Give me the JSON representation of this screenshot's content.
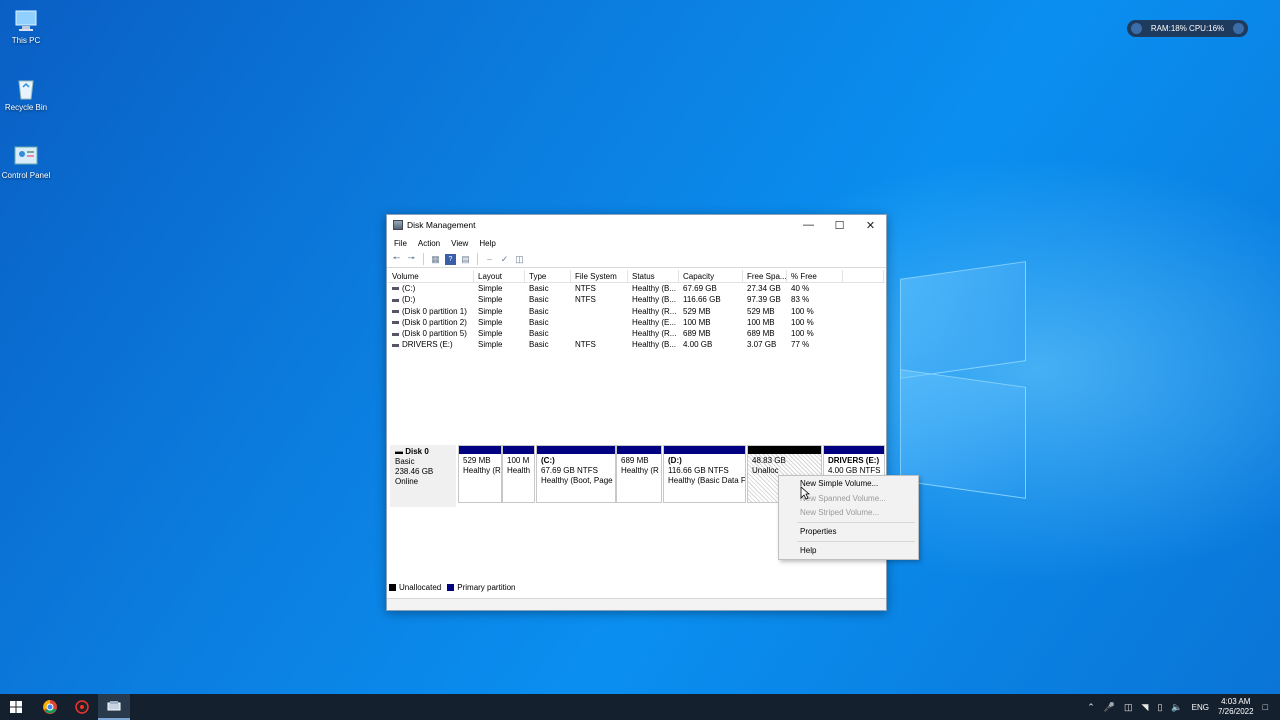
{
  "desktop": {
    "icons": [
      {
        "label": "This PC"
      },
      {
        "label": "Recycle Bin"
      },
      {
        "label": "Control Panel"
      }
    ],
    "sysmon": {
      "text": "RAM:18%  CPU:16%"
    }
  },
  "window": {
    "title": "Disk Management",
    "menu": [
      "File",
      "Action",
      "View",
      "Help"
    ],
    "columns": [
      "Volume",
      "Layout",
      "Type",
      "File System",
      "Status",
      "Capacity",
      "Free Spa...",
      "% Free",
      ""
    ],
    "rows": [
      [
        "(C:)",
        "Simple",
        "Basic",
        "NTFS",
        "Healthy (B...",
        "67.69 GB",
        "27.34 GB",
        "40 %"
      ],
      [
        "(D:)",
        "Simple",
        "Basic",
        "NTFS",
        "Healthy (B...",
        "116.66 GB",
        "97.39 GB",
        "83 %"
      ],
      [
        "(Disk 0 partition 1)",
        "Simple",
        "Basic",
        "",
        "Healthy (R...",
        "529 MB",
        "529 MB",
        "100 %"
      ],
      [
        "(Disk 0 partition 2)",
        "Simple",
        "Basic",
        "",
        "Healthy (E...",
        "100 MB",
        "100 MB",
        "100 %"
      ],
      [
        "(Disk 0 partition 5)",
        "Simple",
        "Basic",
        "",
        "Healthy (R...",
        "689 MB",
        "689 MB",
        "100 %"
      ],
      [
        "DRIVERS (E:)",
        "Simple",
        "Basic",
        "NTFS",
        "Healthy (B...",
        "4.00 GB",
        "3.07 GB",
        "77 %"
      ]
    ],
    "disk": {
      "name": "Disk 0",
      "type": "Basic",
      "size": "238.46 GB",
      "state": "Online",
      "partitions": [
        {
          "title": "",
          "line1": "529 MB",
          "line2": "Healthy (R"
        },
        {
          "title": "",
          "line1": "100 M",
          "line2": "Health"
        },
        {
          "title": "(C:)",
          "line1": "67.69 GB NTFS",
          "line2": "Healthy (Boot, Page"
        },
        {
          "title": "",
          "line1": "689 MB",
          "line2": "Healthy (R"
        },
        {
          "title": "(D:)",
          "line1": "116.66 GB NTFS",
          "line2": "Healthy (Basic Data F"
        },
        {
          "title": "",
          "line1": "48.83 GB",
          "line2": "Unalloc"
        },
        {
          "title": "DRIVERS  (E:)",
          "line1": "4.00 GB NTFS",
          "line2": ""
        }
      ]
    },
    "legend": [
      "Unallocated",
      "Primary partition"
    ]
  },
  "context_menu": {
    "items": [
      {
        "label": "New Simple Volume...",
        "enabled": true
      },
      {
        "label": "New Spanned Volume...",
        "enabled": false
      },
      {
        "label": "New Striped Volume...",
        "enabled": false
      },
      {
        "label": "Properties",
        "enabled": true
      },
      {
        "label": "Help",
        "enabled": true
      }
    ]
  },
  "taskbar": {
    "lang": "ENG",
    "time": "4:03 AM",
    "date": "7/26/2022"
  },
  "colors": {
    "primary_partition": "#000080",
    "unallocated": "#000000",
    "taskbar": "#14202e"
  }
}
